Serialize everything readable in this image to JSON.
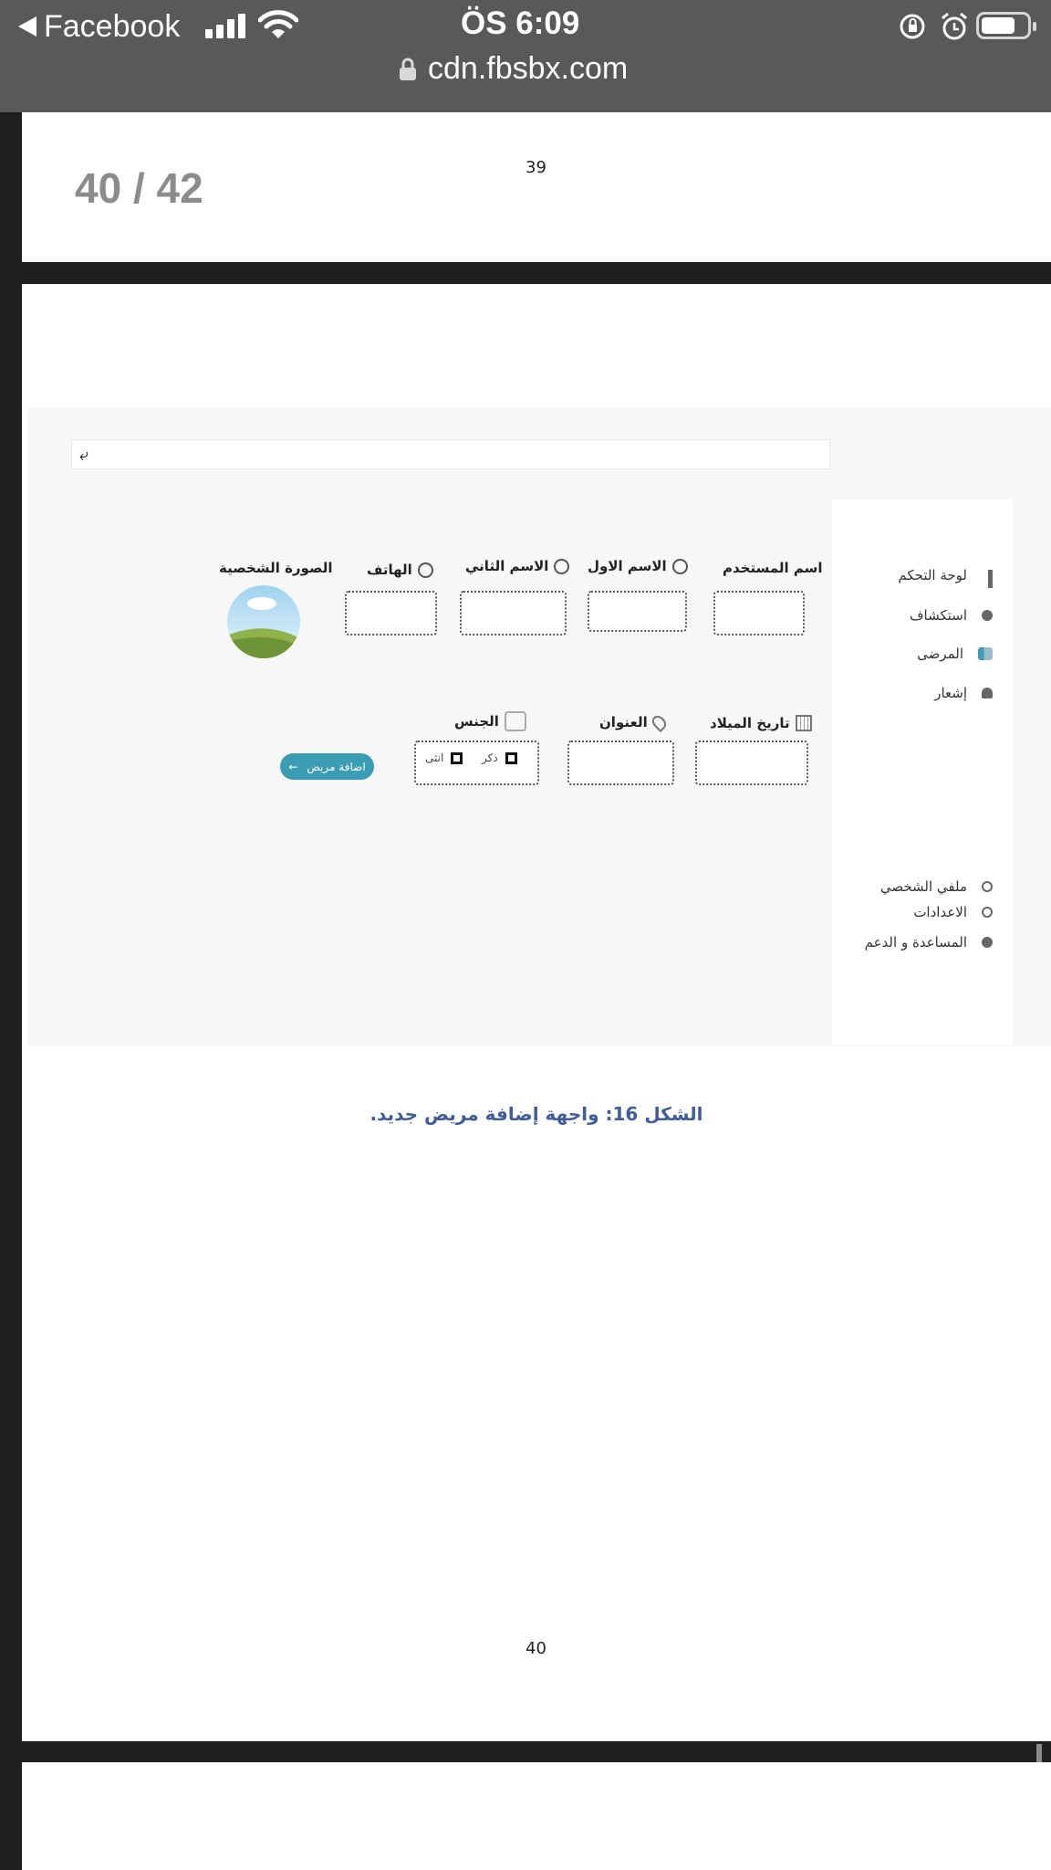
{
  "status_bar": {
    "back_app": "Facebook",
    "time": "ÖS 6:09",
    "url": "cdn.fbsbx.com"
  },
  "viewer": {
    "page_indicator": "40 / 42",
    "prev_page_number": "39",
    "current_page_number": "40"
  },
  "mockup": {
    "sidebar": {
      "items": [
        {
          "label": "لوحة التحكم",
          "icon": "grid-icon"
        },
        {
          "label": "استكشاف",
          "icon": "compass-icon"
        },
        {
          "label": "المرضى",
          "icon": "patients-icon"
        },
        {
          "label": "إشعار",
          "icon": "bell-icon"
        }
      ],
      "bottom_items": [
        {
          "label": "ملفي الشخصي",
          "icon": "user-icon"
        },
        {
          "label": "الاعدادات",
          "icon": "gear-icon"
        },
        {
          "label": "المساعدة و الدعم",
          "icon": "help-icon"
        }
      ]
    },
    "form": {
      "username_label": "اسم المستخدم",
      "first_name_label": "الاسم الاول",
      "second_name_label": "الاسم الثاني",
      "phone_label": "الهاتف",
      "photo_label": "الصورة الشخصية",
      "birthdate_label": "تاريخ الميلاد",
      "address_label": "العنوان",
      "gender_label": "الجنس",
      "gender_male": "ذكر",
      "gender_female": "انثى",
      "submit_label": "اضافة مريض"
    }
  },
  "caption": "الشكل 16: واجهة إضافة مريض جديد."
}
